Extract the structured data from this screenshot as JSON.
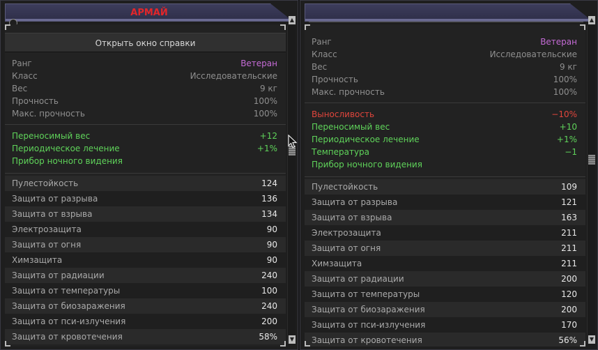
{
  "left": {
    "title": "АРМАЙ",
    "help_button": "Открыть окно справки",
    "stats": [
      {
        "label": "Ранг",
        "value": "Ветеран",
        "kind": "rank"
      },
      {
        "label": "Класс",
        "value": "Исследовательские"
      },
      {
        "label": "Вес",
        "value": "9 кг"
      },
      {
        "label": "Прочность",
        "value": "100%"
      },
      {
        "label": "Макс. прочность",
        "value": "100%"
      }
    ],
    "bonuses": [
      {
        "label": "Переносимый вес",
        "value": "+12"
      },
      {
        "label": "Периодическое лечение",
        "value": "+1%"
      },
      {
        "label": "Прибор ночного видения",
        "value": ""
      }
    ],
    "protection": [
      {
        "label": "Пулестойкость",
        "value": "124"
      },
      {
        "label": "Защита от разрыва",
        "value": "136"
      },
      {
        "label": "Защита от взрыва",
        "value": "134"
      },
      {
        "label": "Электрозащита",
        "value": "90"
      },
      {
        "label": "Защита от огня",
        "value": "90"
      },
      {
        "label": "Химзащита",
        "value": "90"
      },
      {
        "label": "Защита от радиации",
        "value": "240"
      },
      {
        "label": "Защита от температуры",
        "value": "100"
      },
      {
        "label": "Защита от биозаражения",
        "value": "240"
      },
      {
        "label": "Защита от пси-излучения",
        "value": "200"
      },
      {
        "label": "Защита от кровотечения",
        "value": "58%"
      }
    ]
  },
  "right": {
    "title": "",
    "stats": [
      {
        "label": "Ранг",
        "value": "Ветеран",
        "kind": "rank"
      },
      {
        "label": "Класс",
        "value": "Исследовательские"
      },
      {
        "label": "Вес",
        "value": "9 кг"
      },
      {
        "label": "Прочность",
        "value": "100%"
      },
      {
        "label": "Макс. прочность",
        "value": "100%"
      }
    ],
    "bonuses": [
      {
        "label": "Выносливость",
        "value": "−10%",
        "kind": "negative"
      },
      {
        "label": "Переносимый вес",
        "value": "+10"
      },
      {
        "label": "Периодическое лечение",
        "value": "+1%"
      },
      {
        "label": "Температура",
        "value": "−1"
      },
      {
        "label": "Прибор ночного видения",
        "value": ""
      }
    ],
    "protection": [
      {
        "label": "Пулестойкость",
        "value": "109"
      },
      {
        "label": "Защита от разрыва",
        "value": "121"
      },
      {
        "label": "Защита от взрыва",
        "value": "163"
      },
      {
        "label": "Электрозащита",
        "value": "211"
      },
      {
        "label": "Защита от огня",
        "value": "211"
      },
      {
        "label": "Химзащита",
        "value": "211"
      },
      {
        "label": "Защита от радиации",
        "value": "200"
      },
      {
        "label": "Защита от температуры",
        "value": "120"
      },
      {
        "label": "Защита от биозаражения",
        "value": "200"
      },
      {
        "label": "Защита от пси-излучения",
        "value": "170"
      },
      {
        "label": "Защита от кровотечения",
        "value": "56%"
      }
    ]
  },
  "colors": {
    "title_red": "#e3262a",
    "rank_purple": "#c56bd6",
    "bonus_green": "#5fd35a",
    "penalty_red": "#e0453c"
  },
  "icons": {
    "scroll_up": "scroll-up-icon",
    "scroll_down": "scroll-down-icon",
    "cursor": "mouse-cursor-icon"
  },
  "scroll": {
    "left_position": 0.4,
    "right_position": 0.43
  }
}
